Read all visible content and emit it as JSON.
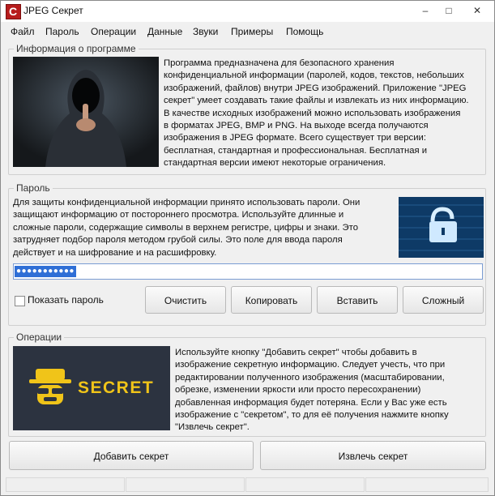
{
  "window": {
    "title": "JPEG Секрет",
    "icon_letter": "C",
    "minimize_glyph": "–",
    "maximize_glyph": "□",
    "close_glyph": "✕"
  },
  "menu": [
    "Файл",
    "Пароль",
    "Операции",
    "Данные",
    "Звуки",
    "Примеры",
    "Помощь"
  ],
  "info_section": {
    "legend": "Информация о программе",
    "image_icon": "hooded-figure-image",
    "lines": [
      "Программа предназначена для безопасного хранения",
      "конфиденциальной информации (паролей, кодов, текстов, небольших",
      "изображений, файлов) внутри JPEG изображений. Приложение \"JPEG",
      "секрет\" умеет создавать такие файлы и извлекать из них информацию.",
      "В качестве исходных изображений можно использовать изображения",
      "в форматах JPEG, BMP и PNG. На выходе всегда получаются",
      "изображения в JPEG формате. Всего существует три версии:",
      "бесплатная, стандартная и профессиональная. Бесплатная и",
      "стандартная версии имеют некоторые ограничения."
    ]
  },
  "password_section": {
    "legend": "Пароль",
    "image_icon": "padlock-image",
    "lines": [
      "Для защиты конфиденциальной информации принято использовать пароли. Они",
      "защищают информацию от постороннего просмотра. Используйте длинные и",
      "сложные пароли, содержащие символы в верхнем регистре, цифры и знаки. Это",
      "затрудняет подбор пароля методом грубой силы. Это поле для ввода пароля",
      "действует и на шифрование и на расшифровку."
    ],
    "password_value": "●●●●●●●●●●●",
    "show_password_label": "Показать пароль",
    "show_password_checked": false,
    "buttons": [
      "Очистить",
      "Копировать",
      "Вставить",
      "Сложный"
    ]
  },
  "operations_section": {
    "legend": "Операции",
    "image_icon": "secret-agent-image",
    "image_word": "SECRET",
    "lines": [
      "Используйте кнопку \"Добавить секрет\" чтобы добавить в",
      "изображение секретную информацию. Следует учесть, что при",
      "редактировании полученного изображения (масштабировании,",
      "обрезке, изменении яркости или просто пересохранении)",
      "добавленная информация будет потеряна. Если у Вас уже есть",
      "изображение с \"секретом\", то для её получения нажмите кнопку",
      "\"Извлечь секрет\"."
    ]
  },
  "actions": {
    "add_secret": "Добавить секрет",
    "extract_secret": "Извлечь секрет"
  },
  "colors": {
    "accent": "#b71c1c",
    "selection": "#2f6fd6",
    "secret_yellow": "#f0c419"
  }
}
